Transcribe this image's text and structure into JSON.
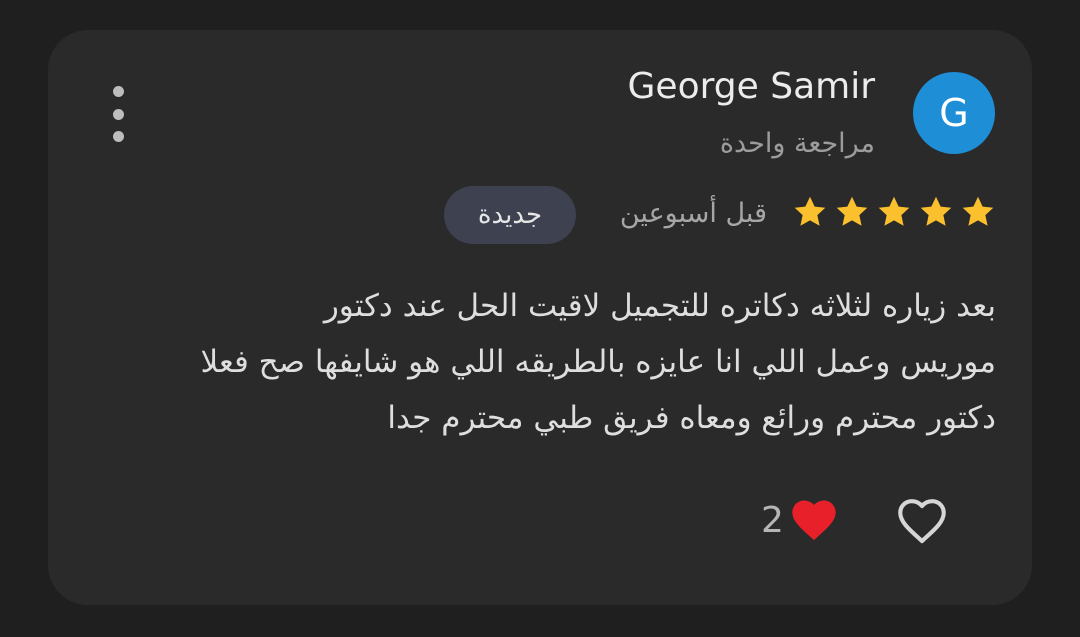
{
  "review": {
    "author_name": "George Samir",
    "avatar_initial": "G",
    "author_subtitle": "مراجعة واحدة",
    "rating": 5,
    "time_ago": "قبل أسبوعين",
    "badge": "جديدة",
    "text_lines": [
      "بعد زياره لثلاثه دكاتره للتجميل لاقيت الحل عند دكتور",
      "موريس وعمل اللي انا عايزه بالطريقه اللي هو شايفها صح فعلا",
      "دكتور محترم ورائع ومعاه فريق طبي محترم جدا"
    ],
    "reaction_count": "2",
    "reaction_icon": "red-heart",
    "like_icon": "heart-outline",
    "menu_icon": "more-vert"
  },
  "colors": {
    "card_bg": "#2a2a2a",
    "avatar_bg": "#1e8fd6",
    "star": "#fbc02d",
    "badge_bg": "#3d4150",
    "heart": "#e8202a"
  }
}
